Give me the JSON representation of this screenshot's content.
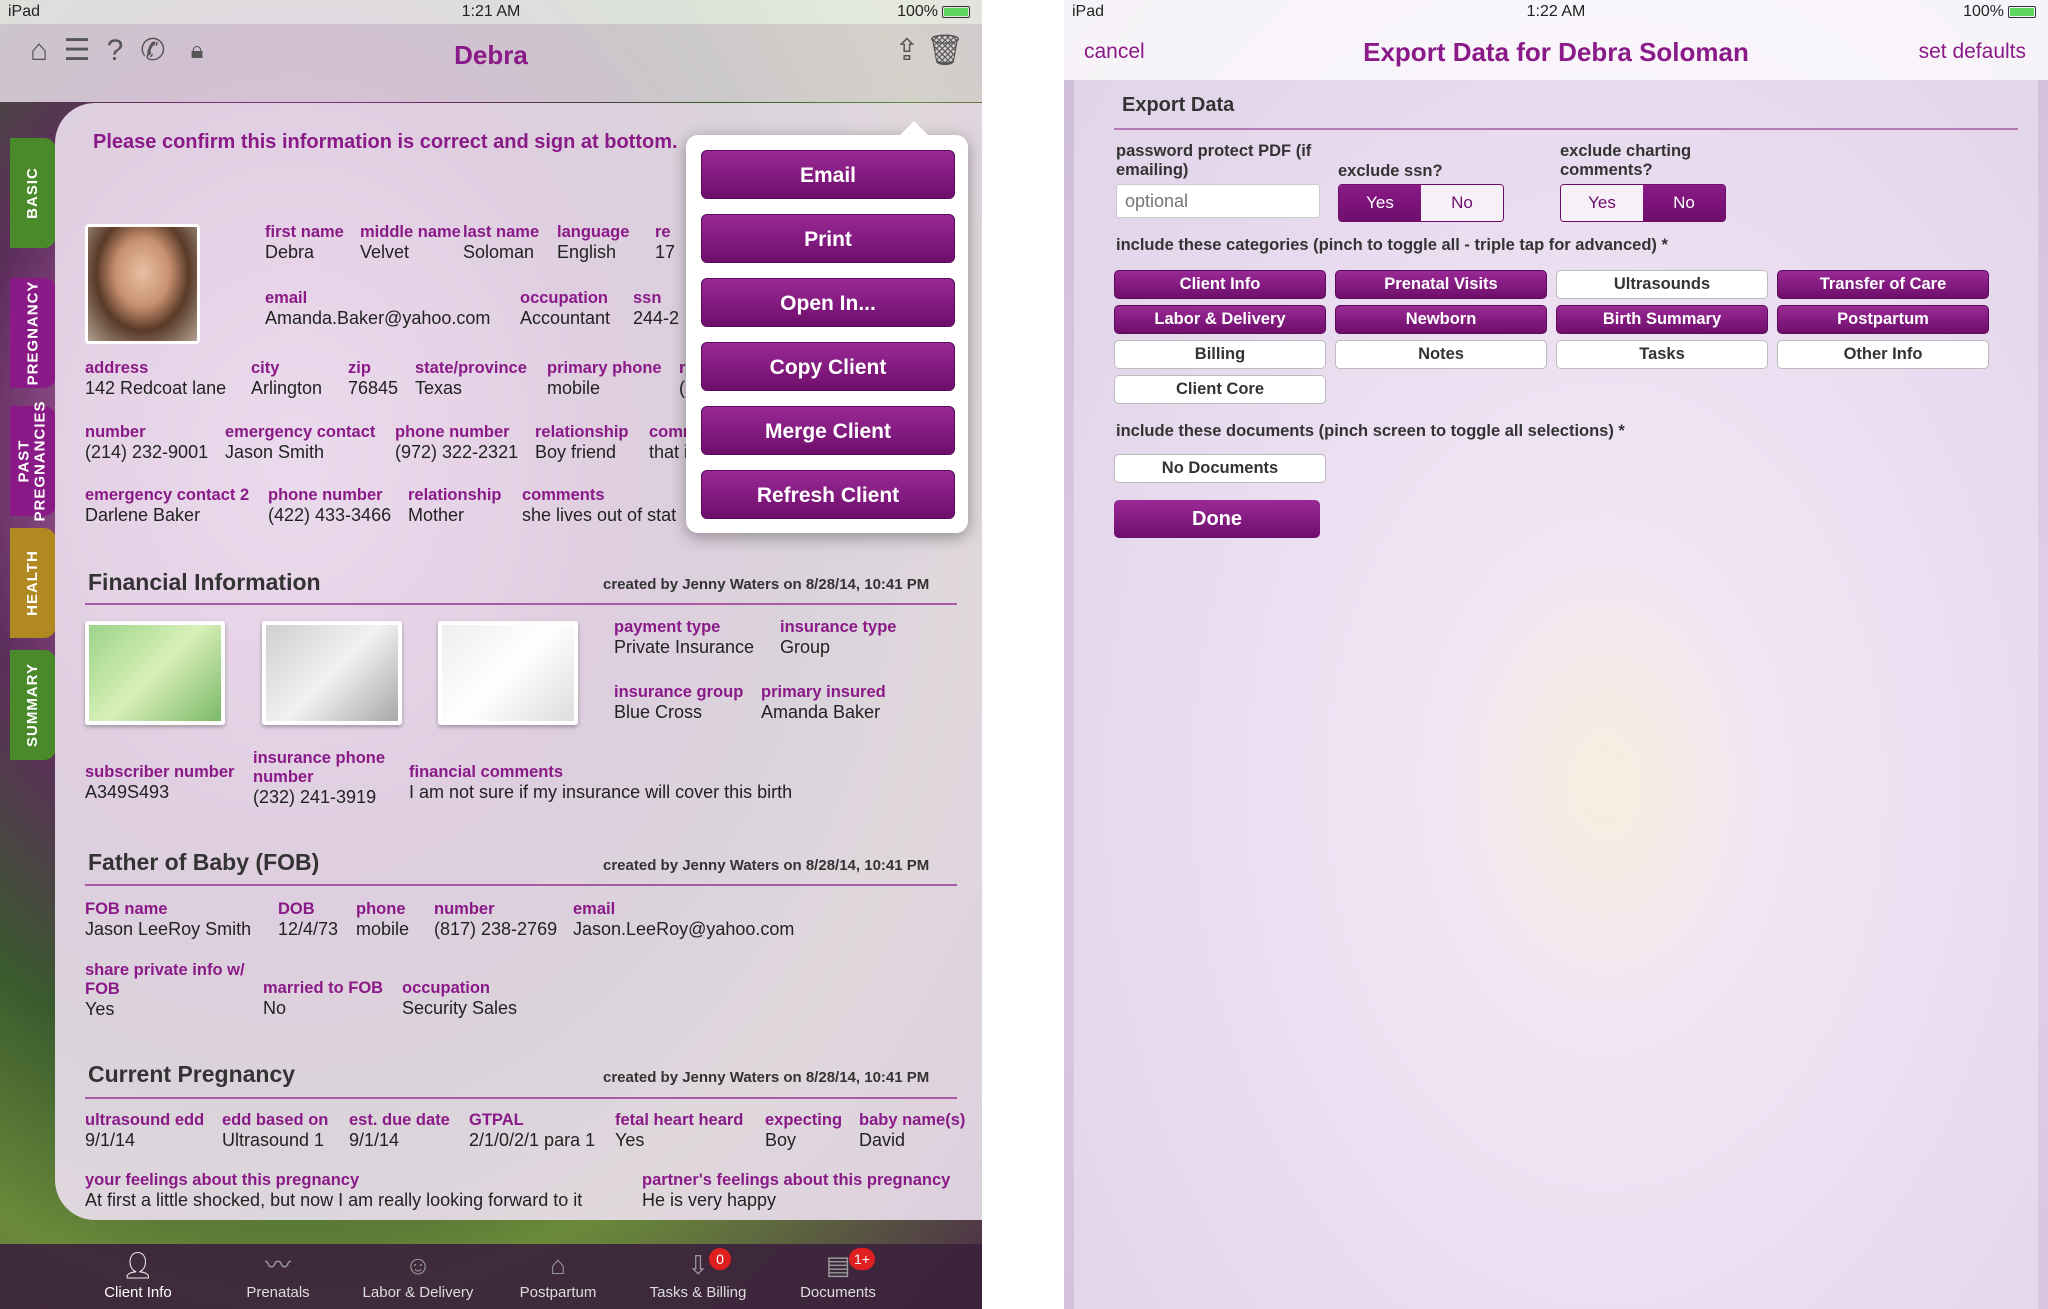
{
  "left": {
    "status": {
      "carrier": "iPad",
      "time": "1:21 AM",
      "battery": "100%"
    },
    "nav": {
      "title": "Debra"
    },
    "side_tabs": [
      "BASIC",
      "PREGNANCY",
      "PAST\nPREGNANCIES",
      "HEALTH",
      "SUMMARY"
    ],
    "confirm_text": "Please confirm this information is correct and sign at bottom.",
    "basic": {
      "first_name": {
        "label": "first name",
        "value": "Debra"
      },
      "middle_name": {
        "label": "middle name",
        "value": "Velvet"
      },
      "last_name": {
        "label": "last name",
        "value": "Soloman"
      },
      "language": {
        "label": "language",
        "value": "English"
      },
      "re": {
        "label": "re",
        "value": "17"
      },
      "email": {
        "label": "email",
        "value": "Amanda.Baker@yahoo.com"
      },
      "occupation": {
        "label": "occupation",
        "value": "Accountant"
      },
      "ssn": {
        "label": "ssn",
        "value": "244-2"
      },
      "address": {
        "label": "address",
        "value": "142 Redcoat lane"
      },
      "city": {
        "label": "city",
        "value": "Arlington"
      },
      "zip": {
        "label": "zip",
        "value": "76845"
      },
      "state": {
        "label": "state/province",
        "value": "Texas"
      },
      "primary_phone": {
        "label": "primary phone",
        "value": "mobile"
      },
      "r2": {
        "label": "r",
        "value": "("
      },
      "number": {
        "label": "number",
        "value": "(214) 232-9001"
      },
      "emergency_contact": {
        "label": "emergency contact",
        "value": "Jason Smith"
      },
      "phone_number": {
        "label": "phone number",
        "value": "(972) 322-2321"
      },
      "relationship": {
        "label": "relationship",
        "value": "Boy friend"
      },
      "comm": {
        "label": "comm",
        "value": "that i"
      },
      "emergency_contact2": {
        "label": "emergency contact 2",
        "value": "Darlene Baker"
      },
      "phone_number2": {
        "label": "phone number",
        "value": "(422) 433-3466"
      },
      "relationship2": {
        "label": "relationship",
        "value": "Mother"
      },
      "comments": {
        "label": "comments",
        "value": "she lives out of stat"
      }
    },
    "financial": {
      "title": "Financial Information",
      "meta": "created by Jenny Waters on 8/28/14, 10:41 PM",
      "payment_type": {
        "label": "payment type",
        "value": "Private Insurance"
      },
      "insurance_type": {
        "label": "insurance type",
        "value": "Group"
      },
      "insurance_group": {
        "label": "insurance group",
        "value": "Blue Cross"
      },
      "primary_insured": {
        "label": "primary insured",
        "value": "Amanda Baker"
      },
      "subscriber_number": {
        "label": "subscriber number",
        "value": "A349S493"
      },
      "insurance_phone": {
        "label": "insurance phone\nnumber",
        "value": "(232) 241-3919"
      },
      "financial_comments": {
        "label": "financial comments",
        "value": "I am not sure if my insurance will cover this birth"
      }
    },
    "fob": {
      "title": "Father of Baby (FOB)",
      "meta": "created by Jenny Waters on 8/28/14, 10:41 PM",
      "fob_name": {
        "label": "FOB name",
        "value": "Jason LeeRoy Smith"
      },
      "dob": {
        "label": "DOB",
        "value": "12/4/73"
      },
      "phone": {
        "label": "phone",
        "value": "mobile"
      },
      "number": {
        "label": "number",
        "value": "(817) 238-2769"
      },
      "email": {
        "label": "email",
        "value": "Jason.LeeRoy@yahoo.com"
      },
      "share": {
        "label": "share private info w/\nFOB",
        "value": "Yes"
      },
      "married": {
        "label": "married to FOB",
        "value": "No"
      },
      "occupation": {
        "label": "occupation",
        "value": "Security Sales"
      }
    },
    "pregnancy": {
      "title": "Current Pregnancy",
      "meta": "created by Jenny Waters on 8/28/14, 10:41 PM",
      "ultrasound_edd": {
        "label": "ultrasound edd",
        "value": "9/1/14"
      },
      "edd_based_on": {
        "label": "edd based on",
        "value": "Ultrasound 1"
      },
      "est_due_date": {
        "label": "est. due date",
        "value": "9/1/14"
      },
      "gtpal": {
        "label": "GTPAL",
        "value": "2/1/0/2/1 para 1"
      },
      "fetal_heart": {
        "label": "fetal heart heard",
        "value": "Yes"
      },
      "expecting": {
        "label": "expecting",
        "value": "Boy"
      },
      "baby_names": {
        "label": "baby name(s)",
        "value": "David"
      },
      "your_feelings": {
        "label": "your feelings about this pregnancy",
        "value": "At first a little shocked, but now I am really looking forward to it"
      },
      "partner_feelings": {
        "label": "partner's feelings about this pregnancy",
        "value": "He is very happy"
      }
    },
    "popover": [
      "Email",
      "Print",
      "Open In...",
      "Copy Client",
      "Merge Client",
      "Refresh Client"
    ],
    "tabbar": [
      {
        "label": "Client Info",
        "icon": "person-icon",
        "badge": ""
      },
      {
        "label": "Prenatals",
        "icon": "heartbeat-icon",
        "badge": ""
      },
      {
        "label": "Labor & Delivery",
        "icon": "baby-icon",
        "badge": ""
      },
      {
        "label": "Postpartum",
        "icon": "house-icon",
        "badge": ""
      },
      {
        "label": "Tasks & Billing",
        "icon": "inbox-icon",
        "badge": "0"
      },
      {
        "label": "Documents",
        "icon": "stack-icon",
        "badge": "1+"
      }
    ]
  },
  "right": {
    "status": {
      "carrier": "iPad",
      "time": "1:22 AM",
      "battery": "100%"
    },
    "nav": {
      "cancel": "cancel",
      "title": "Export Data for Debra Soloman",
      "set_defaults": "set defaults"
    },
    "section_title": "Export Data",
    "password_label": "password protect PDF (if\nemailing)",
    "password_placeholder": "optional",
    "exclude_ssn_label": "exclude ssn?",
    "exclude_ssn_options": [
      "Yes",
      "No"
    ],
    "exclude_ssn_selected": "Yes",
    "exclude_charting_label": "exclude charting\ncomments?",
    "exclude_charting_options": [
      "Yes",
      "No"
    ],
    "exclude_charting_selected": "No",
    "categories_label": "include these categories (pinch to toggle all - triple tap for advanced) *",
    "categories": [
      {
        "label": "Client Info",
        "selected": true
      },
      {
        "label": "Prenatal Visits",
        "selected": true
      },
      {
        "label": "Ultrasounds",
        "selected": false
      },
      {
        "label": "Transfer of Care",
        "selected": true
      },
      {
        "label": "Labor & Delivery",
        "selected": true
      },
      {
        "label": "Newborn",
        "selected": true
      },
      {
        "label": "Birth Summary",
        "selected": true
      },
      {
        "label": "Postpartum",
        "selected": true
      },
      {
        "label": "Billing",
        "selected": false
      },
      {
        "label": "Notes",
        "selected": false
      },
      {
        "label": "Tasks",
        "selected": false
      },
      {
        "label": "Other Info",
        "selected": false
      },
      {
        "label": "Client Core",
        "selected": false
      }
    ],
    "documents_label": "include these documents (pinch screen to toggle all selections) *",
    "documents_button": "No Documents",
    "done": "Done"
  },
  "colors": {
    "accent": "#8a1a87",
    "accent_dark": "#6e0e6b",
    "tab_green": "#4a8a2a",
    "tab_purple": "#8a1a87"
  }
}
